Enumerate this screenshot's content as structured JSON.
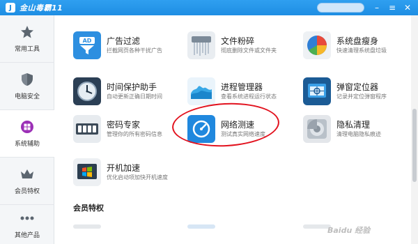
{
  "titlebar": {
    "logo_glyph": "J",
    "title": "金山毒霸11",
    "min_glyph": "–",
    "menu_glyph": "≡",
    "close_glyph": "✕",
    "accent": "#1e8ee3"
  },
  "sidebar": {
    "items": [
      {
        "label": "常用工具",
        "icon": "star-icon"
      },
      {
        "label": "电脑安全",
        "icon": "shield-icon"
      },
      {
        "label": "系统辅助",
        "icon": "windows-icon",
        "active": true
      },
      {
        "label": "会员特权",
        "icon": "crown-icon"
      },
      {
        "label": "其他产品",
        "icon": "more-dots-icon"
      }
    ]
  },
  "tools": [
    {
      "name": "广告过滤",
      "desc": "拦截网页各种干扰广告",
      "icon": "ad-filter-icon"
    },
    {
      "name": "文件粉碎",
      "desc": "彻底删除文件或文件夹",
      "icon": "file-shredder-icon"
    },
    {
      "name": "系统盘瘦身",
      "desc": "快速清理系统盘垃圾",
      "icon": "disk-slim-icon"
    },
    {
      "name": "时间保护助手",
      "desc": "自动更新正确日期时间",
      "icon": "clock-icon"
    },
    {
      "name": "进程管理器",
      "desc": "查看系统进程运行状态",
      "icon": "process-manager-icon"
    },
    {
      "name": "弹窗定位器",
      "desc": "记录并定位弹窗程序",
      "icon": "popup-locator-icon"
    },
    {
      "name": "密码专家",
      "desc": "管理你的所有密码信息",
      "icon": "password-icon"
    },
    {
      "name": "网络测速",
      "desc": "测试真实网络速度",
      "icon": "speedometer-icon"
    },
    {
      "name": "隐私清理",
      "desc": "清理电脑隐私痕迹",
      "icon": "privacy-icon"
    },
    {
      "name": "开机加速",
      "desc": "优化启动项加快开机速度",
      "icon": "boot-speedup-icon"
    }
  ],
  "section": {
    "title": "会员特权"
  },
  "watermark": "Baidu 经验",
  "annotation_color": "#e2121e"
}
